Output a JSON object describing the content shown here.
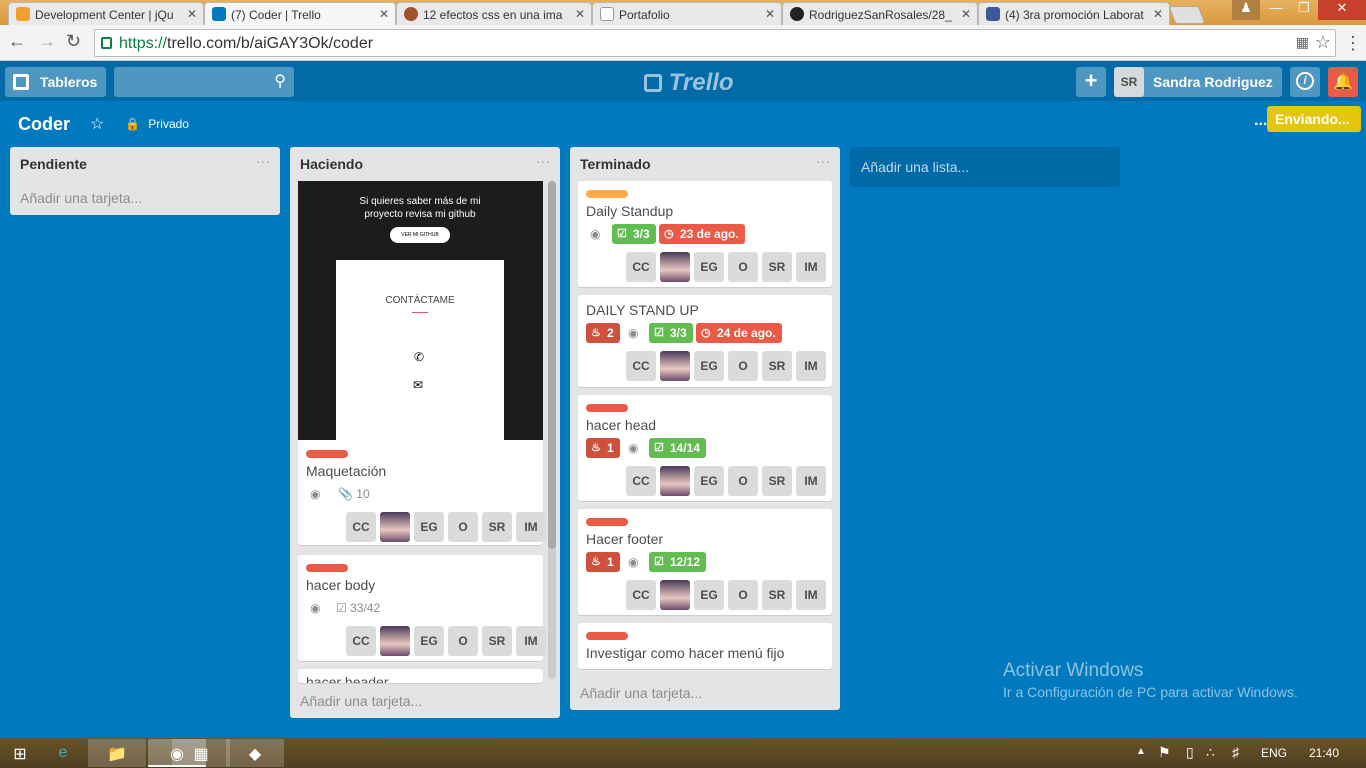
{
  "browser": {
    "tabs": [
      {
        "title": "Development Center | jQu",
        "color": "#f0a030"
      },
      {
        "title": "(7) Coder | Trello",
        "color": "#0079bf"
      },
      {
        "title": "12 efectos css en una ima",
        "color": "#a0522d"
      },
      {
        "title": "Portafolio",
        "color": "#dddddd"
      },
      {
        "title": "RodriguezSanRosales/28_",
        "color": "#222222"
      },
      {
        "title": "(4) 3ra promoción Laborat",
        "color": "#3b5998"
      }
    ],
    "close_glyph": "✕",
    "url_scheme": "https://",
    "url_rest": "trello.com/b/aiGAY3Ok/coder"
  },
  "header": {
    "boards_label": "Tableros",
    "logo": "Trello",
    "user_initials": "SR",
    "user_name": "Sandra Rodriguez"
  },
  "board": {
    "title": "Coder",
    "visibility": "Privado",
    "more": "...",
    "sending": "Enviando..."
  },
  "lists": {
    "pendiente": {
      "title": "Pendiente",
      "add": "Añadir una tarjeta..."
    },
    "haciendo": {
      "title": "Haciendo",
      "add": "Añadir una tarjeta...",
      "cover": {
        "heading": "Si quieres saber más de mi proyecto revisa mi github",
        "button": "VER MI GITHUB",
        "contact": "CONTÁCTAME"
      },
      "cards": [
        {
          "title": "Maquetación",
          "stat": "10"
        },
        {
          "title": "hacer body",
          "stat": "33/42"
        },
        {
          "title": "hacer header"
        }
      ]
    },
    "terminado": {
      "title": "Terminado",
      "add": "Añadir una tarjeta...",
      "cards": [
        {
          "title": "Daily Standup",
          "check": "3/3",
          "due": "23 de ago."
        },
        {
          "title": "DAILY STAND UP",
          "notif": "2",
          "check": "3/3",
          "due": "24 de ago."
        },
        {
          "title": "hacer head",
          "notif": "1",
          "check": "14/14"
        },
        {
          "title": "Hacer footer",
          "notif": "1",
          "check": "12/12"
        },
        {
          "title": "Investigar como hacer menú fijo"
        }
      ]
    }
  },
  "members": [
    "CC",
    "",
    "EG",
    "O",
    "SR",
    "IM"
  ],
  "add_list": "Añadir una lista...",
  "menu_dots": "···",
  "watermark": {
    "line1": "Activar Windows",
    "line2": "Ir a Configuración de PC para activar Windows."
  },
  "taskbar": {
    "lang": "ENG",
    "time": "21:40"
  },
  "colors": {
    "red": "#eb5a46",
    "orange": "#ffab4a",
    "green": "#61bd4f",
    "due_red": "#eb5a46",
    "notif_red": "#cf513d",
    "sending": "#e6c60d"
  }
}
